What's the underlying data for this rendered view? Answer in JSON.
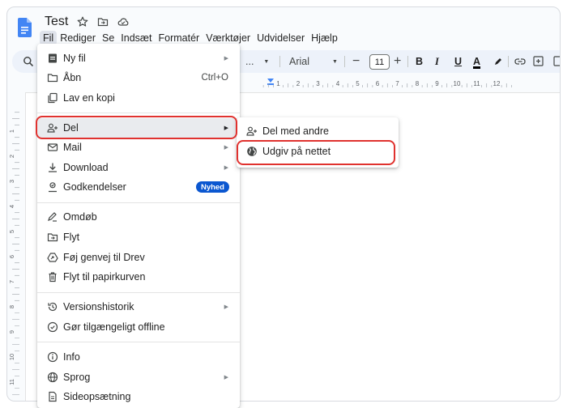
{
  "header": {
    "doc_title": "Test",
    "menu": [
      "Fil",
      "Rediger",
      "Se",
      "Indsæt",
      "Formatér",
      "Værktøjer",
      "Udvidelser",
      "Hjælp"
    ]
  },
  "toolbar": {
    "style_value": "...",
    "font_name": "Arial",
    "font_size": "11",
    "minus": "−",
    "plus": "+",
    "bold": "B",
    "italic": "I",
    "underline": "U",
    "text_color": "A"
  },
  "ruler": {
    "labels": [
      "1",
      "2",
      "3",
      "4",
      "5",
      "6",
      "7",
      "8",
      "9",
      "10",
      "11",
      "12"
    ]
  },
  "fil_menu": {
    "items": [
      {
        "label": "Ny fil",
        "icon": "new-doc-icon",
        "arrow": true
      },
      {
        "label": "Åbn",
        "icon": "folder-icon",
        "shortcut": "Ctrl+O"
      },
      {
        "label": "Lav en kopi",
        "icon": "copy-icon"
      },
      {
        "label": "Del",
        "icon": "share-person-icon",
        "arrow": true
      },
      {
        "label": "Mail",
        "icon": "mail-icon",
        "arrow": true
      },
      {
        "label": "Download",
        "icon": "download-icon",
        "arrow": true
      },
      {
        "label": "Godkendelser",
        "icon": "approvals-icon",
        "badge": "Nyhed"
      },
      {
        "label": "Omdøb",
        "icon": "rename-icon"
      },
      {
        "label": "Flyt",
        "icon": "move-folder-icon"
      },
      {
        "label": "Føj genvej til Drev",
        "icon": "drive-shortcut-icon"
      },
      {
        "label": "Flyt til papirkurven",
        "icon": "trash-icon"
      },
      {
        "label": "Versionshistorik",
        "icon": "history-icon",
        "arrow": true
      },
      {
        "label": "Gør tilgængeligt offline",
        "icon": "offline-icon"
      },
      {
        "label": "Info",
        "icon": "info-icon"
      },
      {
        "label": "Sprog",
        "icon": "globe-icon",
        "arrow": true
      },
      {
        "label": "Sideopsætning",
        "icon": "page-setup-icon"
      }
    ]
  },
  "del_submenu": {
    "items": [
      {
        "label": "Del med andre",
        "icon": "share-person-icon"
      },
      {
        "label": "Udgiv på nettet",
        "icon": "web-globe-icon"
      }
    ]
  },
  "colors": {
    "accent_red": "#e0322f",
    "docs_blue": "#4285f4",
    "badge_blue": "#0b57d0"
  }
}
